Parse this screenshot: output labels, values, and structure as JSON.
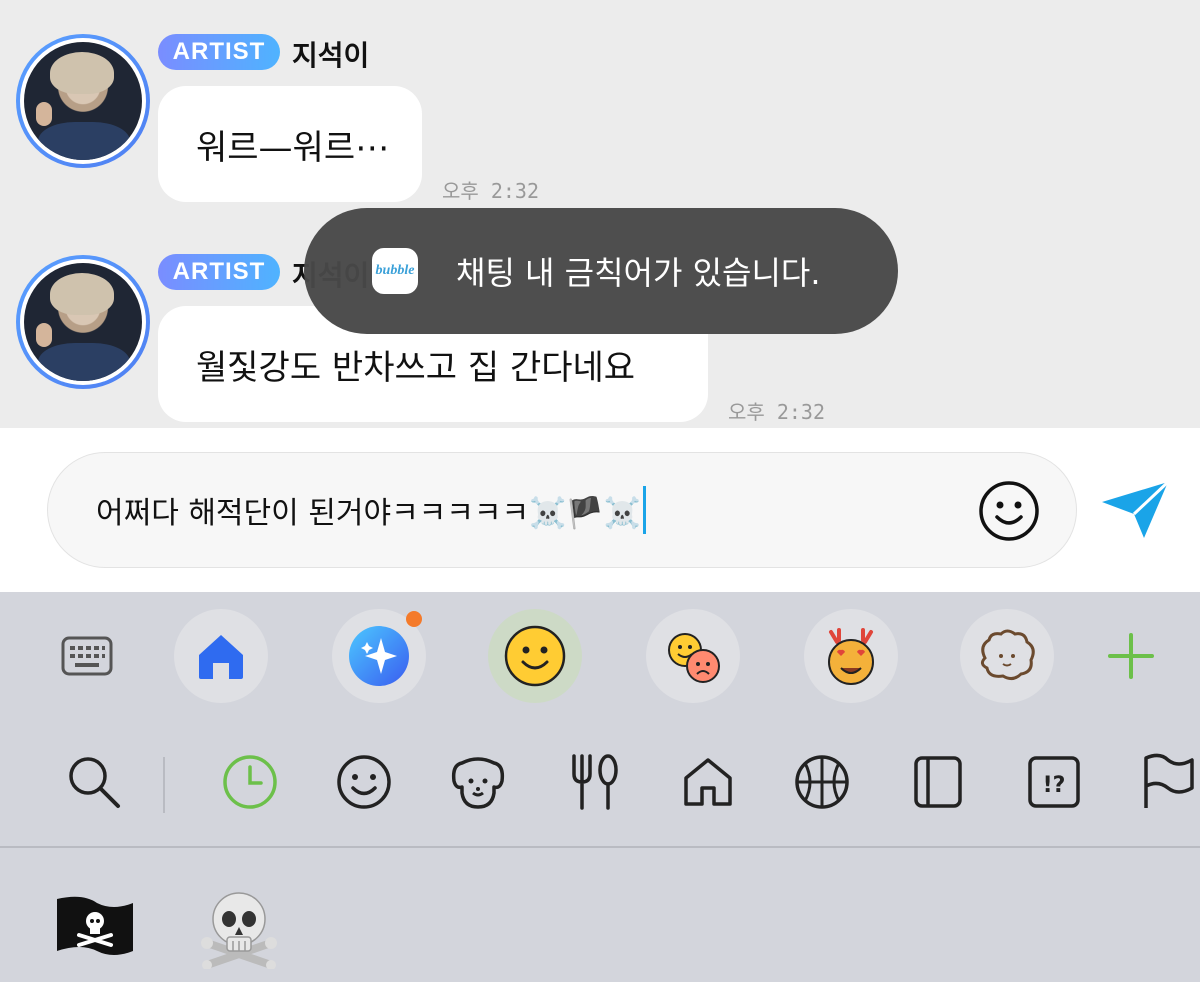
{
  "messages": [
    {
      "badge": "ARTIST",
      "sender": "지석이",
      "text": "워르—워르⋯",
      "time": "오후 2:32"
    },
    {
      "badge": "ARTIST",
      "sender": "지석이",
      "text": "월짗강도 반차쓰고 집 간다네요",
      "time": "오후 2:32"
    }
  ],
  "toast": {
    "logo_text": "bubble",
    "message": "채팅 내 금칙어가 있습니다."
  },
  "composer": {
    "text": "어쩌다 해적단이 된거야ㅋㅋㅋㅋㅋ☠️🏴☠️",
    "emoji_button": "smiley-icon",
    "send_button": "send-icon"
  },
  "keyboard": {
    "packs": [
      "keyboard-icon",
      "home-pack-icon",
      "sparkle-pack-icon",
      "smiley-pack-icon",
      "two-faces-pack-icon",
      "reindeer-pack-icon",
      "dog-sticker-pack-icon",
      "add-pack-icon"
    ],
    "categories": [
      "search-icon",
      "recent-clock-icon",
      "smiley-category-icon",
      "animal-category-icon",
      "food-category-icon",
      "place-category-icon",
      "activity-category-icon",
      "object-category-icon",
      "symbol-category-icon",
      "flag-category-icon"
    ],
    "recent_emojis": [
      "🏴‍☠️",
      "☠️"
    ]
  },
  "colors": {
    "accent": "#1aa4e8",
    "badge_start": "#7a8dff",
    "badge_end": "#4fb3ff",
    "notification_dot": "#f47a2a",
    "recent_clock": "#6cc04a",
    "add_plus": "#6cc04a"
  }
}
